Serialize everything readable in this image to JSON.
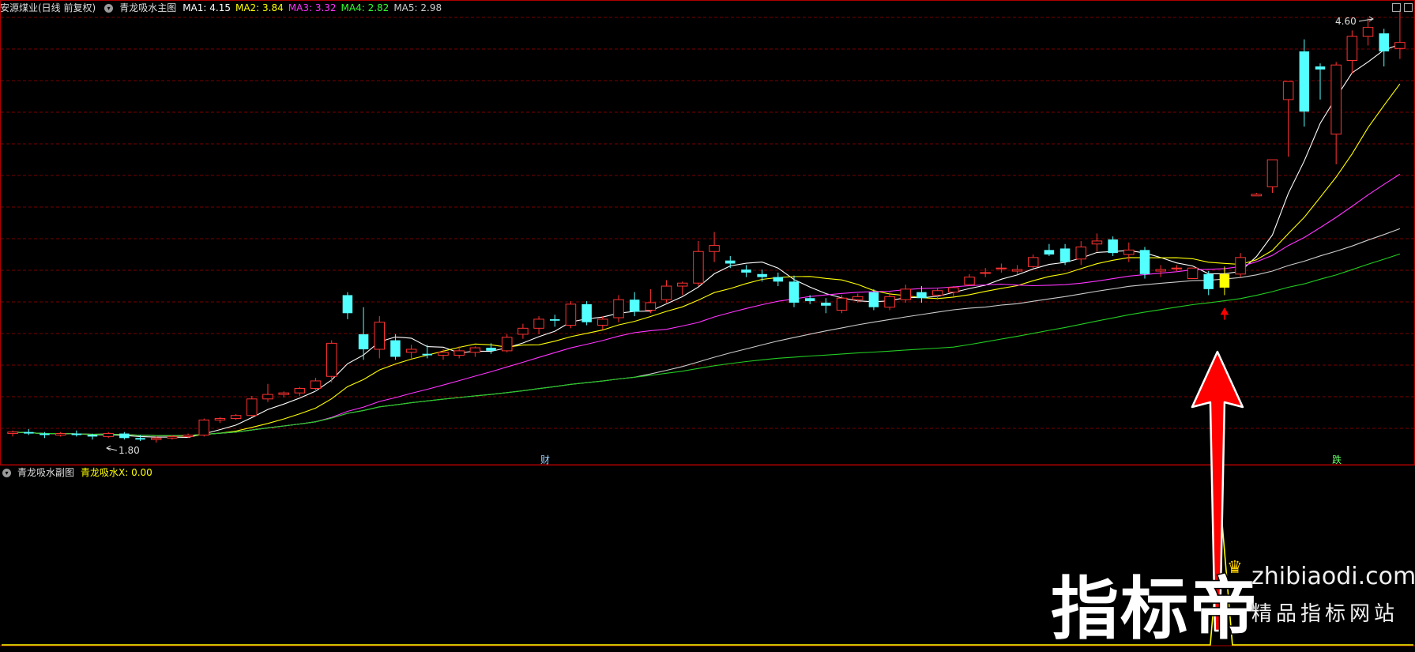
{
  "main_panel": {
    "stock": "安源煤业(日线 前复权)",
    "indicator": "青龙吸水主图",
    "ma_labels": [
      {
        "text": "MA1: 4.15",
        "color": "#ffffff"
      },
      {
        "text": "MA2: 3.84",
        "color": "#ffff00"
      },
      {
        "text": "MA3: 3.32",
        "color": "#ff33ff"
      },
      {
        "text": "MA4: 2.82",
        "color": "#33ff33"
      },
      {
        "text": "MA5: 2.98",
        "color": "#cccccc"
      }
    ],
    "high_label": "4.60",
    "low_label": "1.80",
    "markers": {
      "cai": "财",
      "die": "跌"
    }
  },
  "sub_panel": {
    "indicator": "青龙吸水副图",
    "value_label": "青龙吸水X: 0.00"
  },
  "watermark": {
    "brand_cn": "指标帝",
    "brand_en": "zhibiaodi.com",
    "tagline": "精品指标网站"
  },
  "colors": {
    "up": "#ff3232",
    "down": "#54ffff",
    "grid": "#7a0000",
    "panel_border": "#b00000",
    "highlight": "#ffff00",
    "arrow": "#ff0000"
  },
  "chart_data": {
    "type": "candlestick",
    "price_range": [
      1.8,
      4.6
    ],
    "ohlc": [
      [
        1.86,
        1.88,
        1.84,
        1.87
      ],
      [
        1.87,
        1.89,
        1.85,
        1.86
      ],
      [
        1.86,
        1.87,
        1.83,
        1.85
      ],
      [
        1.85,
        1.87,
        1.84,
        1.86
      ],
      [
        1.86,
        1.88,
        1.84,
        1.85
      ],
      [
        1.85,
        1.86,
        1.82,
        1.84
      ],
      [
        1.84,
        1.87,
        1.83,
        1.86
      ],
      [
        1.86,
        1.87,
        1.82,
        1.83
      ],
      [
        1.83,
        1.85,
        1.81,
        1.82
      ],
      [
        1.82,
        1.84,
        1.8,
        1.83
      ],
      [
        1.83,
        1.85,
        1.82,
        1.84
      ],
      [
        1.84,
        1.86,
        1.83,
        1.85
      ],
      [
        1.85,
        1.96,
        1.84,
        1.95
      ],
      [
        1.95,
        1.97,
        1.93,
        1.96
      ],
      [
        1.96,
        1.99,
        1.95,
        1.98
      ],
      [
        1.98,
        2.11,
        1.97,
        2.09
      ],
      [
        2.09,
        2.19,
        2.07,
        2.12
      ],
      [
        2.12,
        2.14,
        2.1,
        2.13
      ],
      [
        2.13,
        2.17,
        2.11,
        2.16
      ],
      [
        2.16,
        2.23,
        2.14,
        2.21
      ],
      [
        2.24,
        2.48,
        2.2,
        2.46
      ],
      [
        2.78,
        2.8,
        2.62,
        2.66
      ],
      [
        2.52,
        2.7,
        2.35,
        2.42
      ],
      [
        2.42,
        2.64,
        2.36,
        2.6
      ],
      [
        2.48,
        2.52,
        2.35,
        2.37
      ],
      [
        2.4,
        2.45,
        2.36,
        2.42
      ],
      [
        2.39,
        2.45,
        2.36,
        2.38
      ],
      [
        2.38,
        2.42,
        2.35,
        2.4
      ],
      [
        2.38,
        2.44,
        2.36,
        2.41
      ],
      [
        2.4,
        2.44,
        2.37,
        2.43
      ],
      [
        2.43,
        2.46,
        2.39,
        2.41
      ],
      [
        2.41,
        2.52,
        2.4,
        2.5
      ],
      [
        2.52,
        2.59,
        2.49,
        2.56
      ],
      [
        2.56,
        2.64,
        2.52,
        2.62
      ],
      [
        2.62,
        2.65,
        2.57,
        2.61
      ],
      [
        2.58,
        2.74,
        2.56,
        2.72
      ],
      [
        2.72,
        2.74,
        2.58,
        2.6
      ],
      [
        2.58,
        2.64,
        2.55,
        2.62
      ],
      [
        2.63,
        2.78,
        2.6,
        2.75
      ],
      [
        2.75,
        2.8,
        2.64,
        2.67
      ],
      [
        2.68,
        2.82,
        2.66,
        2.73
      ],
      [
        2.75,
        2.88,
        2.73,
        2.84
      ],
      [
        2.84,
        2.87,
        2.78,
        2.86
      ],
      [
        2.86,
        3.14,
        2.84,
        3.07
      ],
      [
        3.07,
        3.2,
        3.0,
        3.11
      ],
      [
        3.01,
        3.04,
        2.96,
        2.99
      ],
      [
        2.95,
        2.98,
        2.9,
        2.93
      ],
      [
        2.92,
        2.95,
        2.87,
        2.9
      ],
      [
        2.9,
        2.93,
        2.84,
        2.87
      ],
      [
        2.87,
        2.91,
        2.7,
        2.73
      ],
      [
        2.76,
        2.78,
        2.72,
        2.74
      ],
      [
        2.73,
        2.76,
        2.66,
        2.71
      ],
      [
        2.68,
        2.78,
        2.66,
        2.76
      ],
      [
        2.75,
        2.79,
        2.73,
        2.77
      ],
      [
        2.8,
        2.82,
        2.68,
        2.7
      ],
      [
        2.7,
        2.8,
        2.68,
        2.77
      ],
      [
        2.75,
        2.85,
        2.73,
        2.82
      ],
      [
        2.8,
        2.84,
        2.73,
        2.76
      ],
      [
        2.78,
        2.83,
        2.75,
        2.81
      ],
      [
        2.8,
        2.84,
        2.77,
        2.83
      ],
      [
        2.85,
        2.92,
        2.84,
        2.9
      ],
      [
        2.93,
        2.96,
        2.9,
        2.93
      ],
      [
        2.96,
        2.99,
        2.93,
        2.96
      ],
      [
        2.94,
        2.98,
        2.92,
        2.95
      ],
      [
        2.97,
        3.05,
        2.96,
        3.03
      ],
      [
        3.08,
        3.12,
        3.04,
        3.05
      ],
      [
        3.09,
        3.12,
        2.98,
        3.0
      ],
      [
        3.02,
        3.14,
        2.98,
        3.1
      ],
      [
        3.12,
        3.19,
        3.07,
        3.14
      ],
      [
        3.15,
        3.17,
        3.04,
        3.06
      ],
      [
        3.05,
        3.13,
        3.0,
        3.08
      ],
      [
        3.08,
        3.1,
        2.89,
        2.92
      ],
      [
        2.94,
        2.98,
        2.9,
        2.95
      ],
      [
        2.96,
        2.98,
        2.94,
        2.96
      ],
      [
        2.89,
        2.91,
        2.93,
        2.96
      ],
      [
        2.92,
        2.94,
        2.78,
        2.82
      ],
      [
        2.83,
        2.97,
        2.78,
        2.92
      ],
      [
        2.92,
        3.06,
        2.9,
        3.03
      ],
      [
        3.44,
        3.46,
        3.44,
        3.45
      ],
      [
        3.5,
        3.68,
        3.46,
        3.68
      ],
      [
        4.08,
        4.2,
        3.7,
        4.2
      ],
      [
        4.4,
        4.48,
        3.9,
        4.0
      ],
      [
        4.3,
        4.32,
        4.08,
        4.28
      ],
      [
        3.85,
        4.33,
        3.65,
        4.31
      ],
      [
        4.34,
        4.54,
        4.25,
        4.5
      ],
      [
        4.5,
        4.62,
        4.44,
        4.56
      ],
      [
        4.52,
        4.55,
        4.3,
        4.4
      ],
      [
        4.42,
        4.68,
        4.35,
        4.46
      ]
    ],
    "highlight_bar_index": 76,
    "signal_bar_index": 76,
    "sub_value": 0.0
  }
}
